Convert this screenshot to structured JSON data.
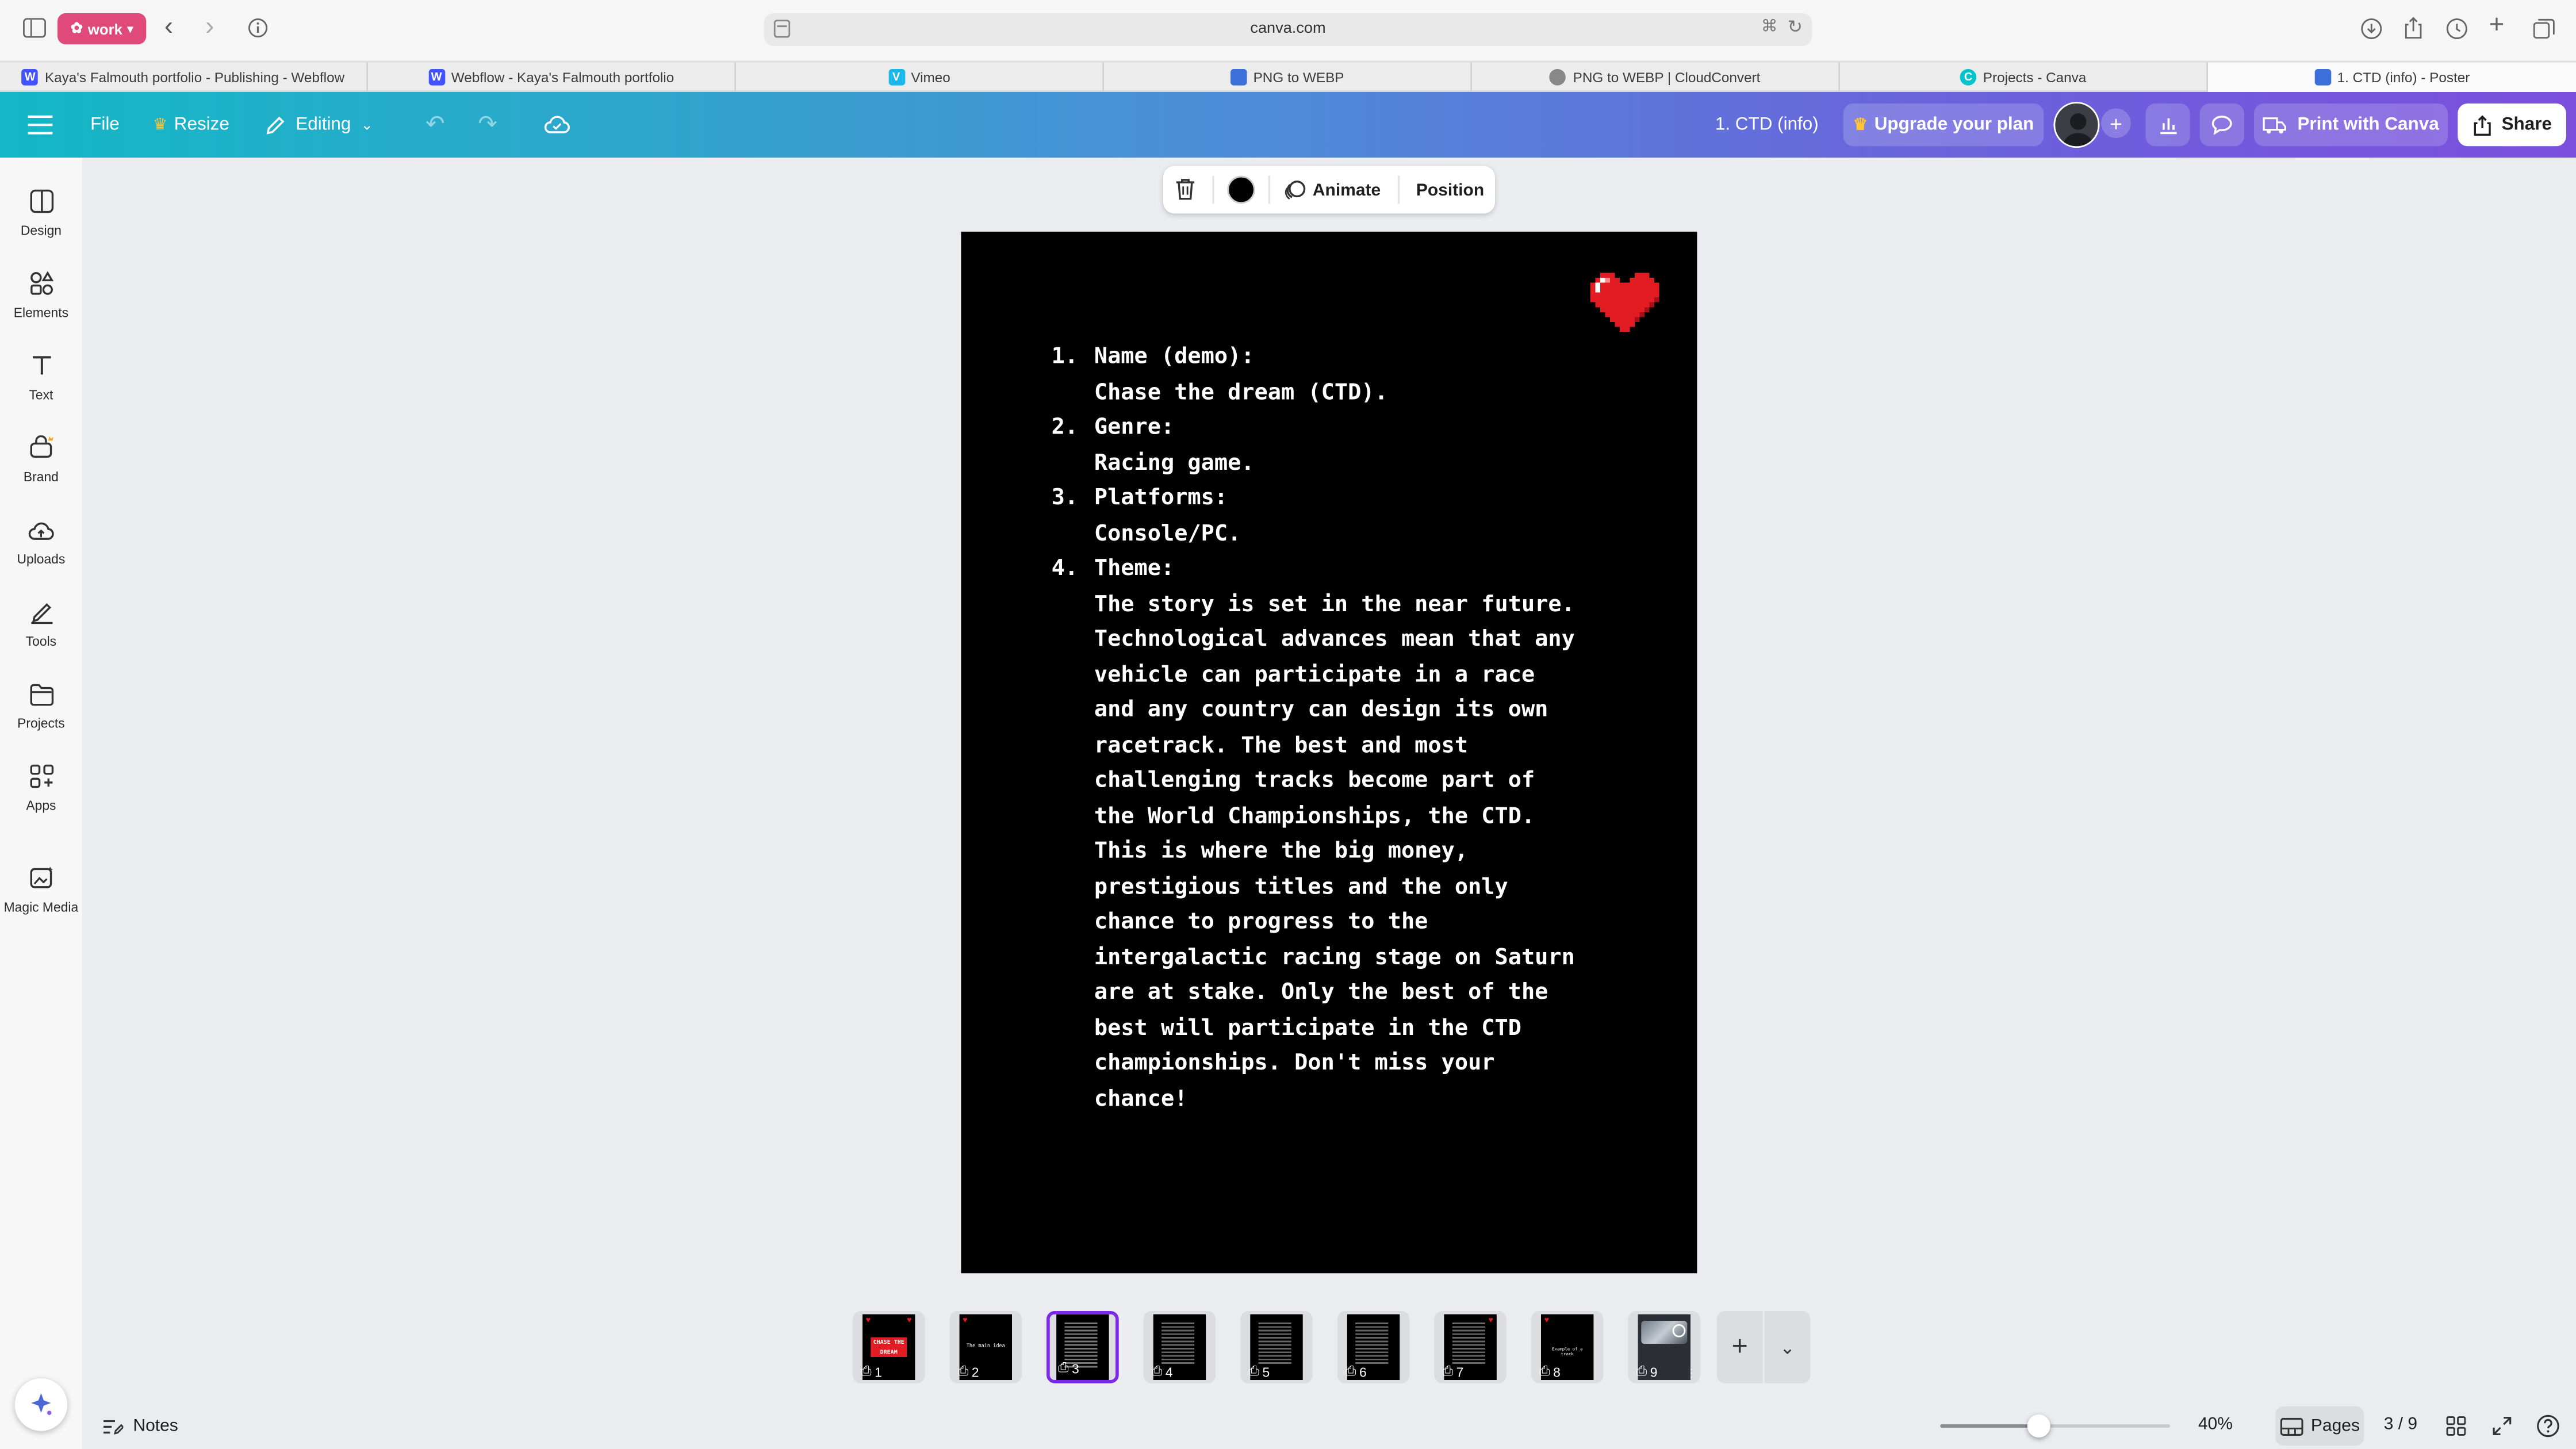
{
  "browser": {
    "workspace_label": "work",
    "address": "canva.com",
    "tabs": [
      {
        "label": "Kaya's Falmouth portfolio - Publishing - Webflow",
        "fav": "W",
        "fav_color": "#4353ff"
      },
      {
        "label": "Webflow - Kaya's Falmouth portfolio",
        "fav": "W",
        "fav_color": "#4353ff"
      },
      {
        "label": "Vimeo",
        "fav": "V",
        "fav_color": "#1ab7ea"
      },
      {
        "label": "PNG to WEBP",
        "fav": "",
        "fav_color": "#3d6fd8"
      },
      {
        "label": "PNG to WEBP | CloudConvert",
        "fav": "",
        "fav_color": "#888888"
      },
      {
        "label": "Projects - Canva",
        "fav": "C",
        "fav_color": "#00c4cc"
      },
      {
        "label": "1. CTD (info) - Poster",
        "fav": "",
        "fav_color": "#3d6fd8"
      }
    ]
  },
  "topbar": {
    "file": "File",
    "resize": "Resize",
    "editing": "Editing",
    "doc_title": "1. CTD (info)",
    "upgrade": "Upgrade your plan",
    "print": "Print with Canva",
    "share": "Share"
  },
  "sidebar": {
    "items": [
      {
        "label": "Design",
        "icon": "design-icon"
      },
      {
        "label": "Elements",
        "icon": "elements-icon"
      },
      {
        "label": "Text",
        "icon": "text-icon"
      },
      {
        "label": "Brand",
        "icon": "brand-icon"
      },
      {
        "label": "Uploads",
        "icon": "uploads-icon"
      },
      {
        "label": "Tools",
        "icon": "tools-icon"
      },
      {
        "label": "Projects",
        "icon": "projects-icon"
      },
      {
        "label": "Apps",
        "icon": "apps-icon"
      },
      {
        "label": "Magic Media",
        "icon": "magic-media-icon"
      }
    ]
  },
  "context_toolbar": {
    "animate": "Animate",
    "position": "Position",
    "text_color": "#000000"
  },
  "poster": {
    "items": [
      {
        "num": "1.",
        "heading": "Name (demo):",
        "lines": [
          "Chase the dream (CTD)."
        ]
      },
      {
        "num": "2.",
        "heading": "Genre:",
        "lines": [
          "Racing game."
        ]
      },
      {
        "num": "3.",
        "heading": "Platforms:",
        "lines": [
          "Console/PC."
        ]
      },
      {
        "num": "4.",
        "heading": "Theme:",
        "lines": [
          "The story is set in the near future.",
          "Technological advances mean that any",
          "vehicle can participate in a race",
          "and any country can design its own",
          "racetrack. The best and most",
          "challenging tracks become part of",
          "the World Championships, the CTD.",
          "This is where the big money,",
          "prestigious titles and the only",
          "chance to progress to the",
          "intergalactic racing stage on Saturn",
          "are at stake. Only the best of the",
          "best will participate in the CTD",
          "championships. Don't miss your",
          "chance!"
        ]
      }
    ]
  },
  "pages": {
    "thumbs": [
      "1",
      "2",
      "3",
      "4",
      "5",
      "6",
      "7",
      "8",
      "9"
    ],
    "selected": 3,
    "thumb1_text": "CHASE THE DREAM",
    "thumb2_text": "The main idea",
    "thumb8_text": "Example of a track"
  },
  "bottom": {
    "notes": "Notes",
    "zoom": "40%",
    "zoom_fraction": 0.4,
    "pages_label": "Pages",
    "page_counter": "3 / 9"
  }
}
